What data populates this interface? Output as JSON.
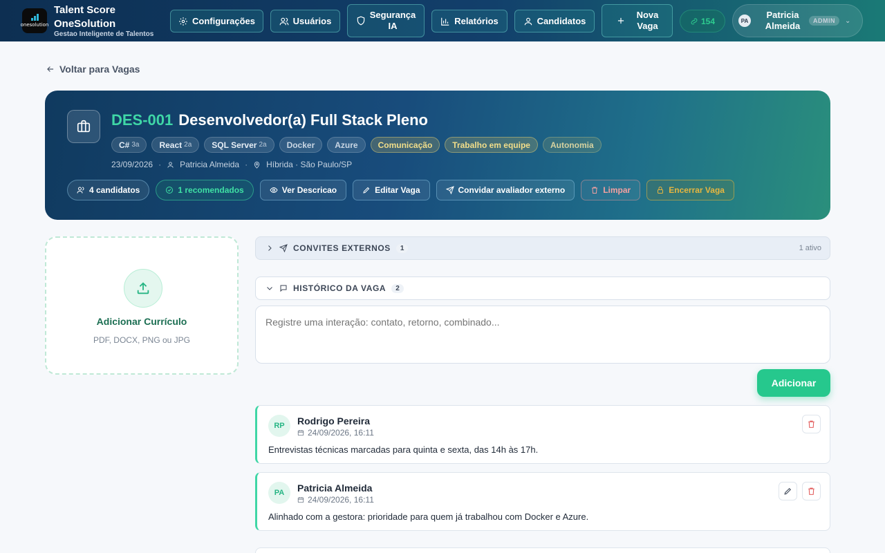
{
  "brand": {
    "title_line1": "Talent Score",
    "title_line2": "OneSolution",
    "subtitle": "Gestao Inteligente de Talentos",
    "logo_text": "onesolution"
  },
  "nav": {
    "configuracoes": "Configurações",
    "usuarios": "Usuários",
    "seguranca_line1": "Segurança",
    "seguranca_line2": "IA",
    "relatorios": "Relatórios",
    "candidatos": "Candidatos",
    "nova_line1": "Nova",
    "nova_line2": "Vaga",
    "count": "154"
  },
  "user": {
    "initials": "PA",
    "name_line1": "Patricia",
    "name_line2": "Almeida",
    "role": "ADMIN"
  },
  "back": {
    "label": "Voltar para Vagas"
  },
  "job": {
    "code": "DES-001",
    "title": "Desenvolvedor(a) Full Stack Pleno",
    "skills": [
      {
        "name": "C#",
        "level": "3a"
      },
      {
        "name": "React",
        "level": "2a"
      },
      {
        "name": "SQL Server",
        "level": "2a"
      },
      {
        "name": "Docker",
        "level": ""
      },
      {
        "name": "Azure",
        "level": ""
      }
    ],
    "soft_skills": [
      "Comunicação",
      "Trabalho em equipe",
      "Autonomia"
    ],
    "date": "23/09/2026",
    "owner": "Patricia Almeida",
    "location": "Híbrida · São Paulo/SP"
  },
  "actions": {
    "candidatos": "4 candidatos",
    "recomendados": "1 recomendados",
    "ver_descricao": "Ver Descricao",
    "editar": "Editar Vaga",
    "convidar": "Convidar avaliador externo",
    "limpar": "Limpar",
    "encerrar": "Encerrar Vaga"
  },
  "upload": {
    "title": "Adicionar Currículo",
    "formats": "PDF, DOCX, PNG ou JPG"
  },
  "convites": {
    "label": "CONVITES EXTERNOS",
    "count": "1",
    "status": "1 ativo"
  },
  "historico": {
    "label": "HISTÓRICO DA VAGA",
    "count": "2"
  },
  "interaction": {
    "placeholder": "Registre uma interação: contato, retorno, combinado...",
    "add_label": "Adicionar"
  },
  "entries": [
    {
      "initials": "RP",
      "name": "Rodrigo Pereira",
      "date": "24/09/2026, 16:11",
      "text": "Entrevistas técnicas marcadas para quinta e sexta, das 14h às 17h."
    },
    {
      "initials": "PA",
      "name": "Patricia Almeida",
      "date": "24/09/2026, 16:11",
      "text": "Alinhado com a gestora: prioridade para quem já trabalhou com Docker e Azure."
    }
  ],
  "colors": {
    "accent": "#26c88d",
    "nav_start": "#0d2f52",
    "nav_end": "#1a7a76",
    "danger": "#e25b5b",
    "warning": "#e6b640"
  }
}
